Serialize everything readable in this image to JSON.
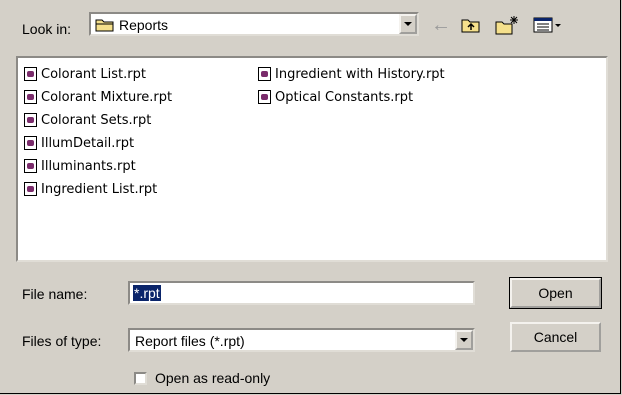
{
  "look_in": {
    "label": "Look in:",
    "value": "Reports",
    "icon": "folder-icon"
  },
  "toolbar": {
    "back_icon": "back-arrow-icon",
    "up_icon": "up-one-level-icon",
    "new_folder_icon": "new-folder-icon",
    "views_icon": "view-menu-icon"
  },
  "files": [
    {
      "name": "Colorant List.rpt"
    },
    {
      "name": "Colorant Mixture.rpt"
    },
    {
      "name": "Colorant Sets.rpt"
    },
    {
      "name": "IllumDetail.rpt"
    },
    {
      "name": "Illuminants.rpt"
    },
    {
      "name": "Ingredient List.rpt"
    },
    {
      "name": "Ingredient with History.rpt"
    },
    {
      "name": "Optical Constants.rpt"
    }
  ],
  "file_name": {
    "label": "File name:",
    "value": "*.rpt"
  },
  "file_type": {
    "label": "Files of type:",
    "value": "Report files (*.rpt)"
  },
  "buttons": {
    "open": "Open",
    "cancel": "Cancel"
  },
  "readonly": {
    "label": "Open as read-only",
    "checked": false
  },
  "colors": {
    "face": "#d4d0c8",
    "selection": "#0a246a"
  }
}
